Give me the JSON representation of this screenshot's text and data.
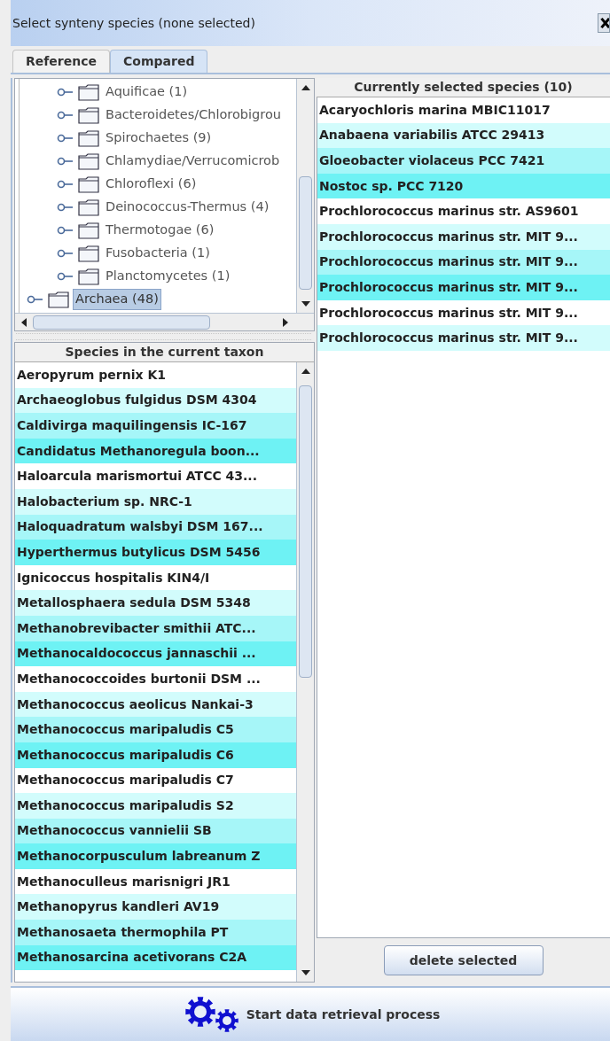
{
  "window": {
    "title": "Select synteny species (none selected)"
  },
  "tabs": [
    {
      "label": "Reference",
      "selected": false
    },
    {
      "label": "Compared",
      "selected": true
    }
  ],
  "taxon_tree": {
    "items": [
      {
        "children": [
          {
            "label": "Aquificae (1)",
            "selected": false
          },
          {
            "label": "Bacteroidetes/Chlorobigrou",
            "selected": false
          },
          {
            "label": "Spirochaetes (9)",
            "selected": false
          },
          {
            "label": "Chlamydiae/Verrucomicrob",
            "selected": false
          },
          {
            "label": "Chloroflexi (6)",
            "selected": false
          },
          {
            "label": "Deinococcus-Thermus (4)",
            "selected": false
          },
          {
            "label": "Thermotogae (6)",
            "selected": false
          },
          {
            "label": "Fusobacteria (1)",
            "selected": false
          },
          {
            "label": "Planctomycetes (1)",
            "selected": false
          }
        ]
      },
      {
        "label": "Archaea (48)",
        "selected": true
      }
    ]
  },
  "species_list": {
    "header": "Species in the current taxon",
    "rows": [
      {
        "name": "Aeropyrum pernix K1",
        "color": "#ffffff"
      },
      {
        "name": "Archaeoglobus fulgidus DSM 4304",
        "color": "#d2fcfc"
      },
      {
        "name": "Caldivirga maquilingensis IC-167",
        "color": "#a6f6f8"
      },
      {
        "name": "Candidatus Methanoregula boon...",
        "color": "#6ef2f4"
      },
      {
        "name": "Haloarcula marismortui ATCC 43...",
        "color": "#ffffff"
      },
      {
        "name": "Halobacterium sp. NRC-1",
        "color": "#d2fcfc"
      },
      {
        "name": "Haloquadratum walsbyi DSM 167...",
        "color": "#a6f6f8"
      },
      {
        "name": "Hyperthermus butylicus DSM 5456",
        "color": "#6ef2f4"
      },
      {
        "name": "Ignicoccus hospitalis KIN4/I",
        "color": "#ffffff"
      },
      {
        "name": "Metallosphaera sedula DSM 5348",
        "color": "#d2fcfc"
      },
      {
        "name": "Methanobrevibacter smithii ATC...",
        "color": "#a6f6f8"
      },
      {
        "name": "Methanocaldococcus jannaschii ...",
        "color": "#6ef2f4"
      },
      {
        "name": "Methanococcoides burtonii DSM ...",
        "color": "#ffffff"
      },
      {
        "name": "Methanococcus aeolicus Nankai-3",
        "color": "#d2fcfc"
      },
      {
        "name": "Methanococcus maripaludis C5",
        "color": "#a6f6f8"
      },
      {
        "name": "Methanococcus maripaludis C6",
        "color": "#6ef2f4"
      },
      {
        "name": "Methanococcus maripaludis C7",
        "color": "#ffffff"
      },
      {
        "name": "Methanococcus maripaludis S2",
        "color": "#d2fcfc"
      },
      {
        "name": "Methanococcus vannielii SB",
        "color": "#a6f6f8"
      },
      {
        "name": "Methanocorpusculum labreanum Z",
        "color": "#6ef2f4"
      },
      {
        "name": "Methanoculleus marisnigri JR1",
        "color": "#ffffff"
      },
      {
        "name": "Methanopyrus kandleri AV19",
        "color": "#d2fcfc"
      },
      {
        "name": "Methanosaeta thermophila PT",
        "color": "#a6f6f8"
      },
      {
        "name": "Methanosarcina acetivorans C2A",
        "color": "#6ef2f4"
      }
    ]
  },
  "selected_list": {
    "header": "Currently selected species (10)",
    "rows": [
      {
        "name": "Acaryochloris marina MBIC11017",
        "color": "#ffffff"
      },
      {
        "name": "Anabaena variabilis ATCC 29413",
        "color": "#d2fcfc"
      },
      {
        "name": "Gloeobacter violaceus PCC 7421",
        "color": "#a6f6f8"
      },
      {
        "name": "Nostoc sp. PCC 7120",
        "color": "#6ef2f4"
      },
      {
        "name": "Prochlorococcus marinus str. AS9601",
        "color": "#ffffff"
      },
      {
        "name": "Prochlorococcus marinus str. MIT 9...",
        "color": "#d2fcfc"
      },
      {
        "name": "Prochlorococcus marinus str. MIT 9...",
        "color": "#a6f6f8"
      },
      {
        "name": "Prochlorococcus marinus str. MIT 9...",
        "color": "#6ef2f4"
      },
      {
        "name": "Prochlorococcus marinus str. MIT 9...",
        "color": "#ffffff"
      },
      {
        "name": "Prochlorococcus marinus str. MIT 9...",
        "color": "#d2fcfc"
      }
    ]
  },
  "delete_button": {
    "label": "delete selected"
  },
  "start_button": {
    "label": "Start data retrieval process"
  }
}
